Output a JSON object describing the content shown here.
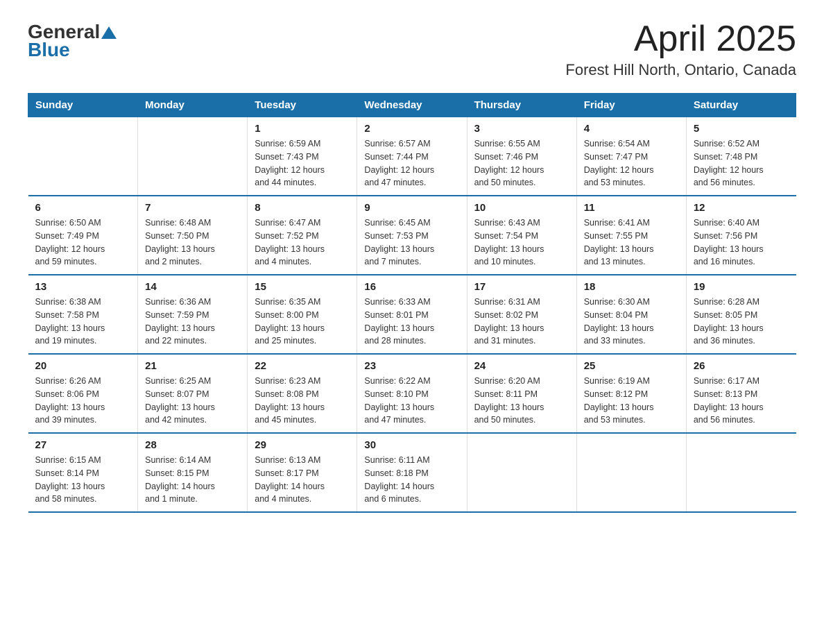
{
  "header": {
    "logo_general": "General",
    "logo_blue": "Blue",
    "month_year": "April 2025",
    "location": "Forest Hill North, Ontario, Canada"
  },
  "days_of_week": [
    "Sunday",
    "Monday",
    "Tuesday",
    "Wednesday",
    "Thursday",
    "Friday",
    "Saturday"
  ],
  "weeks": [
    [
      {
        "day": "",
        "info": ""
      },
      {
        "day": "",
        "info": ""
      },
      {
        "day": "1",
        "info": "Sunrise: 6:59 AM\nSunset: 7:43 PM\nDaylight: 12 hours\nand 44 minutes."
      },
      {
        "day": "2",
        "info": "Sunrise: 6:57 AM\nSunset: 7:44 PM\nDaylight: 12 hours\nand 47 minutes."
      },
      {
        "day": "3",
        "info": "Sunrise: 6:55 AM\nSunset: 7:46 PM\nDaylight: 12 hours\nand 50 minutes."
      },
      {
        "day": "4",
        "info": "Sunrise: 6:54 AM\nSunset: 7:47 PM\nDaylight: 12 hours\nand 53 minutes."
      },
      {
        "day": "5",
        "info": "Sunrise: 6:52 AM\nSunset: 7:48 PM\nDaylight: 12 hours\nand 56 minutes."
      }
    ],
    [
      {
        "day": "6",
        "info": "Sunrise: 6:50 AM\nSunset: 7:49 PM\nDaylight: 12 hours\nand 59 minutes."
      },
      {
        "day": "7",
        "info": "Sunrise: 6:48 AM\nSunset: 7:50 PM\nDaylight: 13 hours\nand 2 minutes."
      },
      {
        "day": "8",
        "info": "Sunrise: 6:47 AM\nSunset: 7:52 PM\nDaylight: 13 hours\nand 4 minutes."
      },
      {
        "day": "9",
        "info": "Sunrise: 6:45 AM\nSunset: 7:53 PM\nDaylight: 13 hours\nand 7 minutes."
      },
      {
        "day": "10",
        "info": "Sunrise: 6:43 AM\nSunset: 7:54 PM\nDaylight: 13 hours\nand 10 minutes."
      },
      {
        "day": "11",
        "info": "Sunrise: 6:41 AM\nSunset: 7:55 PM\nDaylight: 13 hours\nand 13 minutes."
      },
      {
        "day": "12",
        "info": "Sunrise: 6:40 AM\nSunset: 7:56 PM\nDaylight: 13 hours\nand 16 minutes."
      }
    ],
    [
      {
        "day": "13",
        "info": "Sunrise: 6:38 AM\nSunset: 7:58 PM\nDaylight: 13 hours\nand 19 minutes."
      },
      {
        "day": "14",
        "info": "Sunrise: 6:36 AM\nSunset: 7:59 PM\nDaylight: 13 hours\nand 22 minutes."
      },
      {
        "day": "15",
        "info": "Sunrise: 6:35 AM\nSunset: 8:00 PM\nDaylight: 13 hours\nand 25 minutes."
      },
      {
        "day": "16",
        "info": "Sunrise: 6:33 AM\nSunset: 8:01 PM\nDaylight: 13 hours\nand 28 minutes."
      },
      {
        "day": "17",
        "info": "Sunrise: 6:31 AM\nSunset: 8:02 PM\nDaylight: 13 hours\nand 31 minutes."
      },
      {
        "day": "18",
        "info": "Sunrise: 6:30 AM\nSunset: 8:04 PM\nDaylight: 13 hours\nand 33 minutes."
      },
      {
        "day": "19",
        "info": "Sunrise: 6:28 AM\nSunset: 8:05 PM\nDaylight: 13 hours\nand 36 minutes."
      }
    ],
    [
      {
        "day": "20",
        "info": "Sunrise: 6:26 AM\nSunset: 8:06 PM\nDaylight: 13 hours\nand 39 minutes."
      },
      {
        "day": "21",
        "info": "Sunrise: 6:25 AM\nSunset: 8:07 PM\nDaylight: 13 hours\nand 42 minutes."
      },
      {
        "day": "22",
        "info": "Sunrise: 6:23 AM\nSunset: 8:08 PM\nDaylight: 13 hours\nand 45 minutes."
      },
      {
        "day": "23",
        "info": "Sunrise: 6:22 AM\nSunset: 8:10 PM\nDaylight: 13 hours\nand 47 minutes."
      },
      {
        "day": "24",
        "info": "Sunrise: 6:20 AM\nSunset: 8:11 PM\nDaylight: 13 hours\nand 50 minutes."
      },
      {
        "day": "25",
        "info": "Sunrise: 6:19 AM\nSunset: 8:12 PM\nDaylight: 13 hours\nand 53 minutes."
      },
      {
        "day": "26",
        "info": "Sunrise: 6:17 AM\nSunset: 8:13 PM\nDaylight: 13 hours\nand 56 minutes."
      }
    ],
    [
      {
        "day": "27",
        "info": "Sunrise: 6:15 AM\nSunset: 8:14 PM\nDaylight: 13 hours\nand 58 minutes."
      },
      {
        "day": "28",
        "info": "Sunrise: 6:14 AM\nSunset: 8:15 PM\nDaylight: 14 hours\nand 1 minute."
      },
      {
        "day": "29",
        "info": "Sunrise: 6:13 AM\nSunset: 8:17 PM\nDaylight: 14 hours\nand 4 minutes."
      },
      {
        "day": "30",
        "info": "Sunrise: 6:11 AM\nSunset: 8:18 PM\nDaylight: 14 hours\nand 6 minutes."
      },
      {
        "day": "",
        "info": ""
      },
      {
        "day": "",
        "info": ""
      },
      {
        "day": "",
        "info": ""
      }
    ]
  ]
}
